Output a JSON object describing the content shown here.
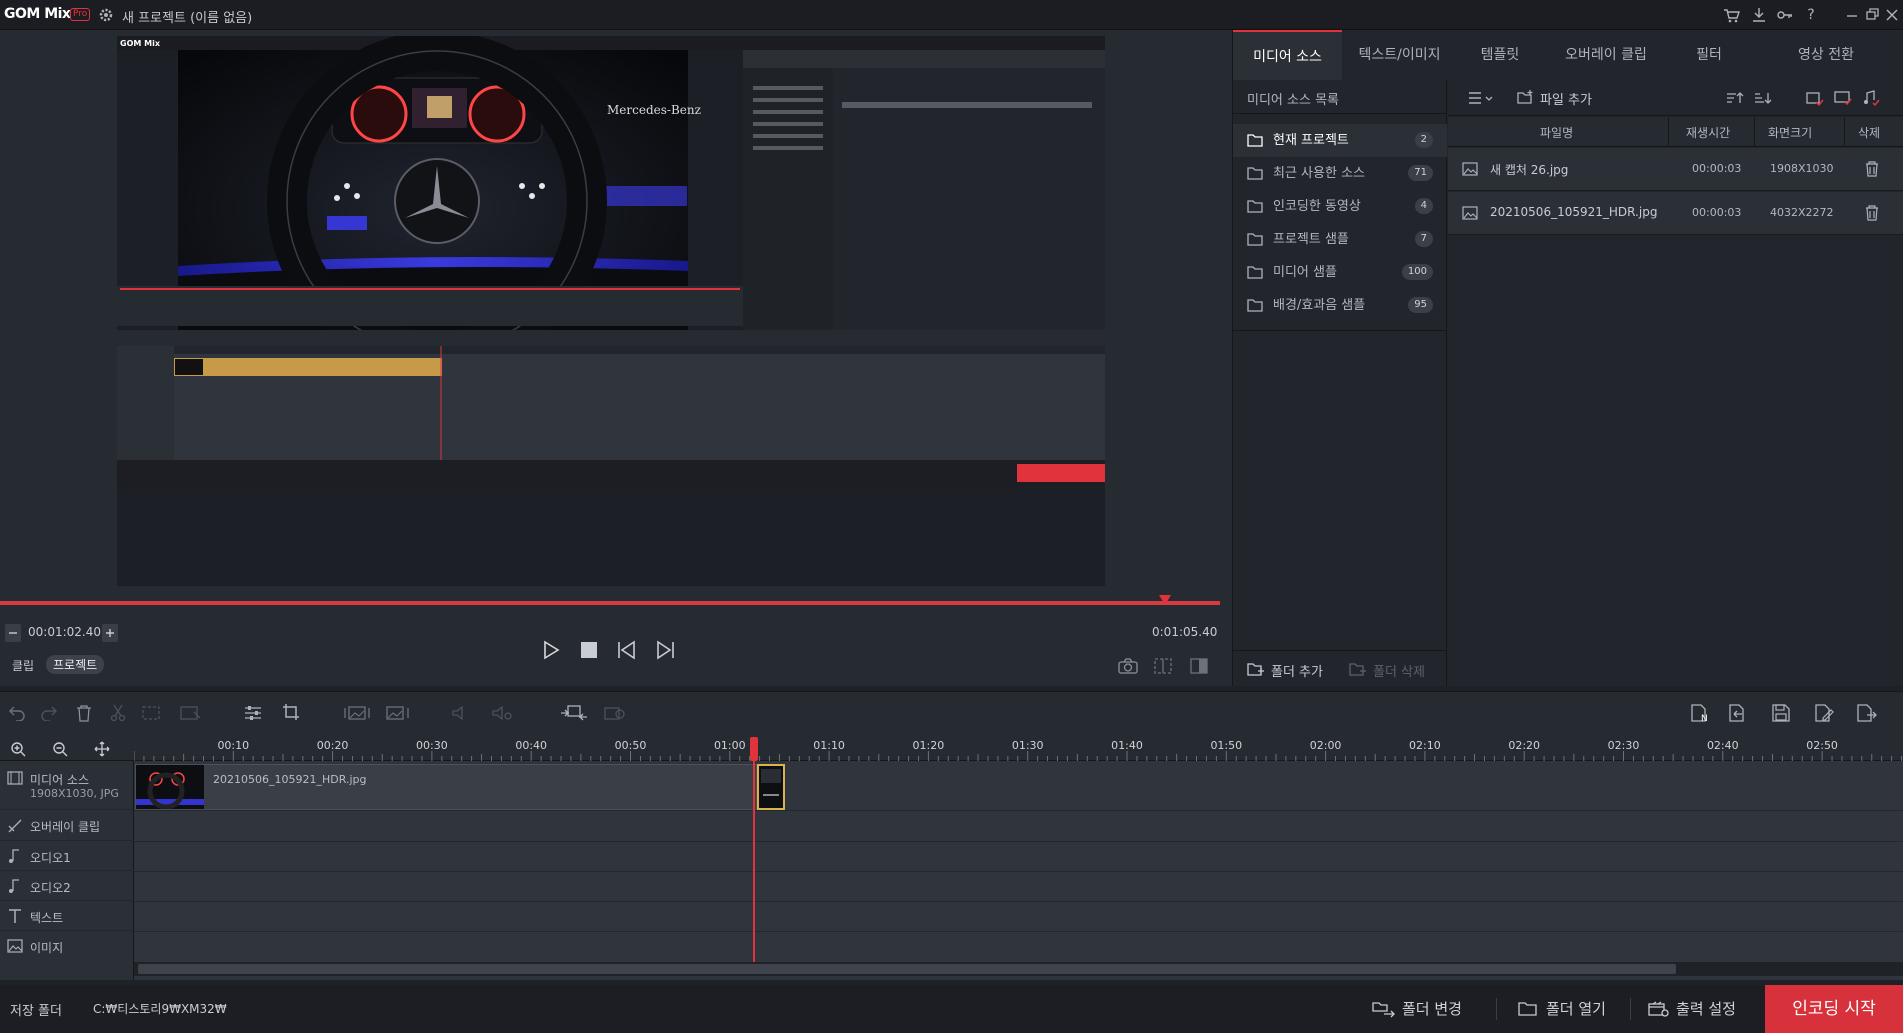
{
  "app": {
    "logo": "GOM Mix",
    "edition": "Pro",
    "project_title": "새 프로젝트 (이름 없음)"
  },
  "preview": {
    "current_time": "00:01:02.40",
    "total_time": "0:01:05.40",
    "progress": 0.955,
    "mode_clip": "클립",
    "mode_project": "프로젝트"
  },
  "tabs": [
    {
      "label": "미디어 소스",
      "active": true
    },
    {
      "label": "텍스트/이미지"
    },
    {
      "label": "템플릿"
    },
    {
      "label": "오버레이 클립"
    },
    {
      "label": "필터"
    },
    {
      "label": "영상 전환"
    }
  ],
  "media": {
    "list_title": "미디어 소스 목록",
    "folders": [
      {
        "label": "현재 프로젝트",
        "count": "2",
        "active": true
      },
      {
        "label": "최근 사용한 소스",
        "count": "71"
      },
      {
        "label": "인코딩한 동영상",
        "count": "4"
      },
      {
        "label": "프로젝트 샘플",
        "count": "7"
      },
      {
        "label": "미디어 샘플",
        "count": "100"
      },
      {
        "label": "배경/효과음 샘플",
        "count": "95"
      }
    ],
    "add_file": "파일 추가",
    "columns": {
      "name": "파일명",
      "duration": "재생시간",
      "size": "화면크기",
      "delete": "삭제"
    },
    "files": [
      {
        "name": "새 캡처 26.jpg",
        "duration": "00:00:03",
        "size": "1908X1030"
      },
      {
        "name": "20210506_105921_HDR.jpg",
        "duration": "00:00:03",
        "size": "4032X2272"
      }
    ],
    "add_folder": "폴더 추가",
    "delete_folder": "폴더 삭제"
  },
  "timeline": {
    "ticks": [
      "00:10",
      "00:20",
      "00:30",
      "00:40",
      "00:50",
      "01:00",
      "01:10",
      "01:20",
      "01:30",
      "01:40",
      "01:50",
      "02:00",
      "02:10",
      "02:20",
      "02:30",
      "02:40",
      "02:50"
    ],
    "tracks": [
      {
        "label": "미디어 소스",
        "sub": "1908X1030, JPG",
        "icon": "film-icon"
      },
      {
        "label": "오버레이 클립",
        "icon": "overlay-icon"
      },
      {
        "label": "오디오1",
        "icon": "music-note-icon"
      },
      {
        "label": "오디오2",
        "icon": "music-note-icon"
      },
      {
        "label": "텍스트",
        "icon": "text-icon"
      },
      {
        "label": "이미지",
        "icon": "image-icon"
      }
    ],
    "clip_label": "20210506_105921_HDR.jpg"
  },
  "bottom": {
    "save_folder_label": "저장 폴더",
    "save_path": "C:₩티스토리9₩XM32₩",
    "change_folder": "폴더 변경",
    "open_folder": "폴더 열기",
    "output_settings": "출력 설정",
    "start_encoding": "인코딩 시작"
  },
  "colors": {
    "accent": "#e0333c",
    "clip_selected": "#c79a4a",
    "background": "#1e2127"
  }
}
